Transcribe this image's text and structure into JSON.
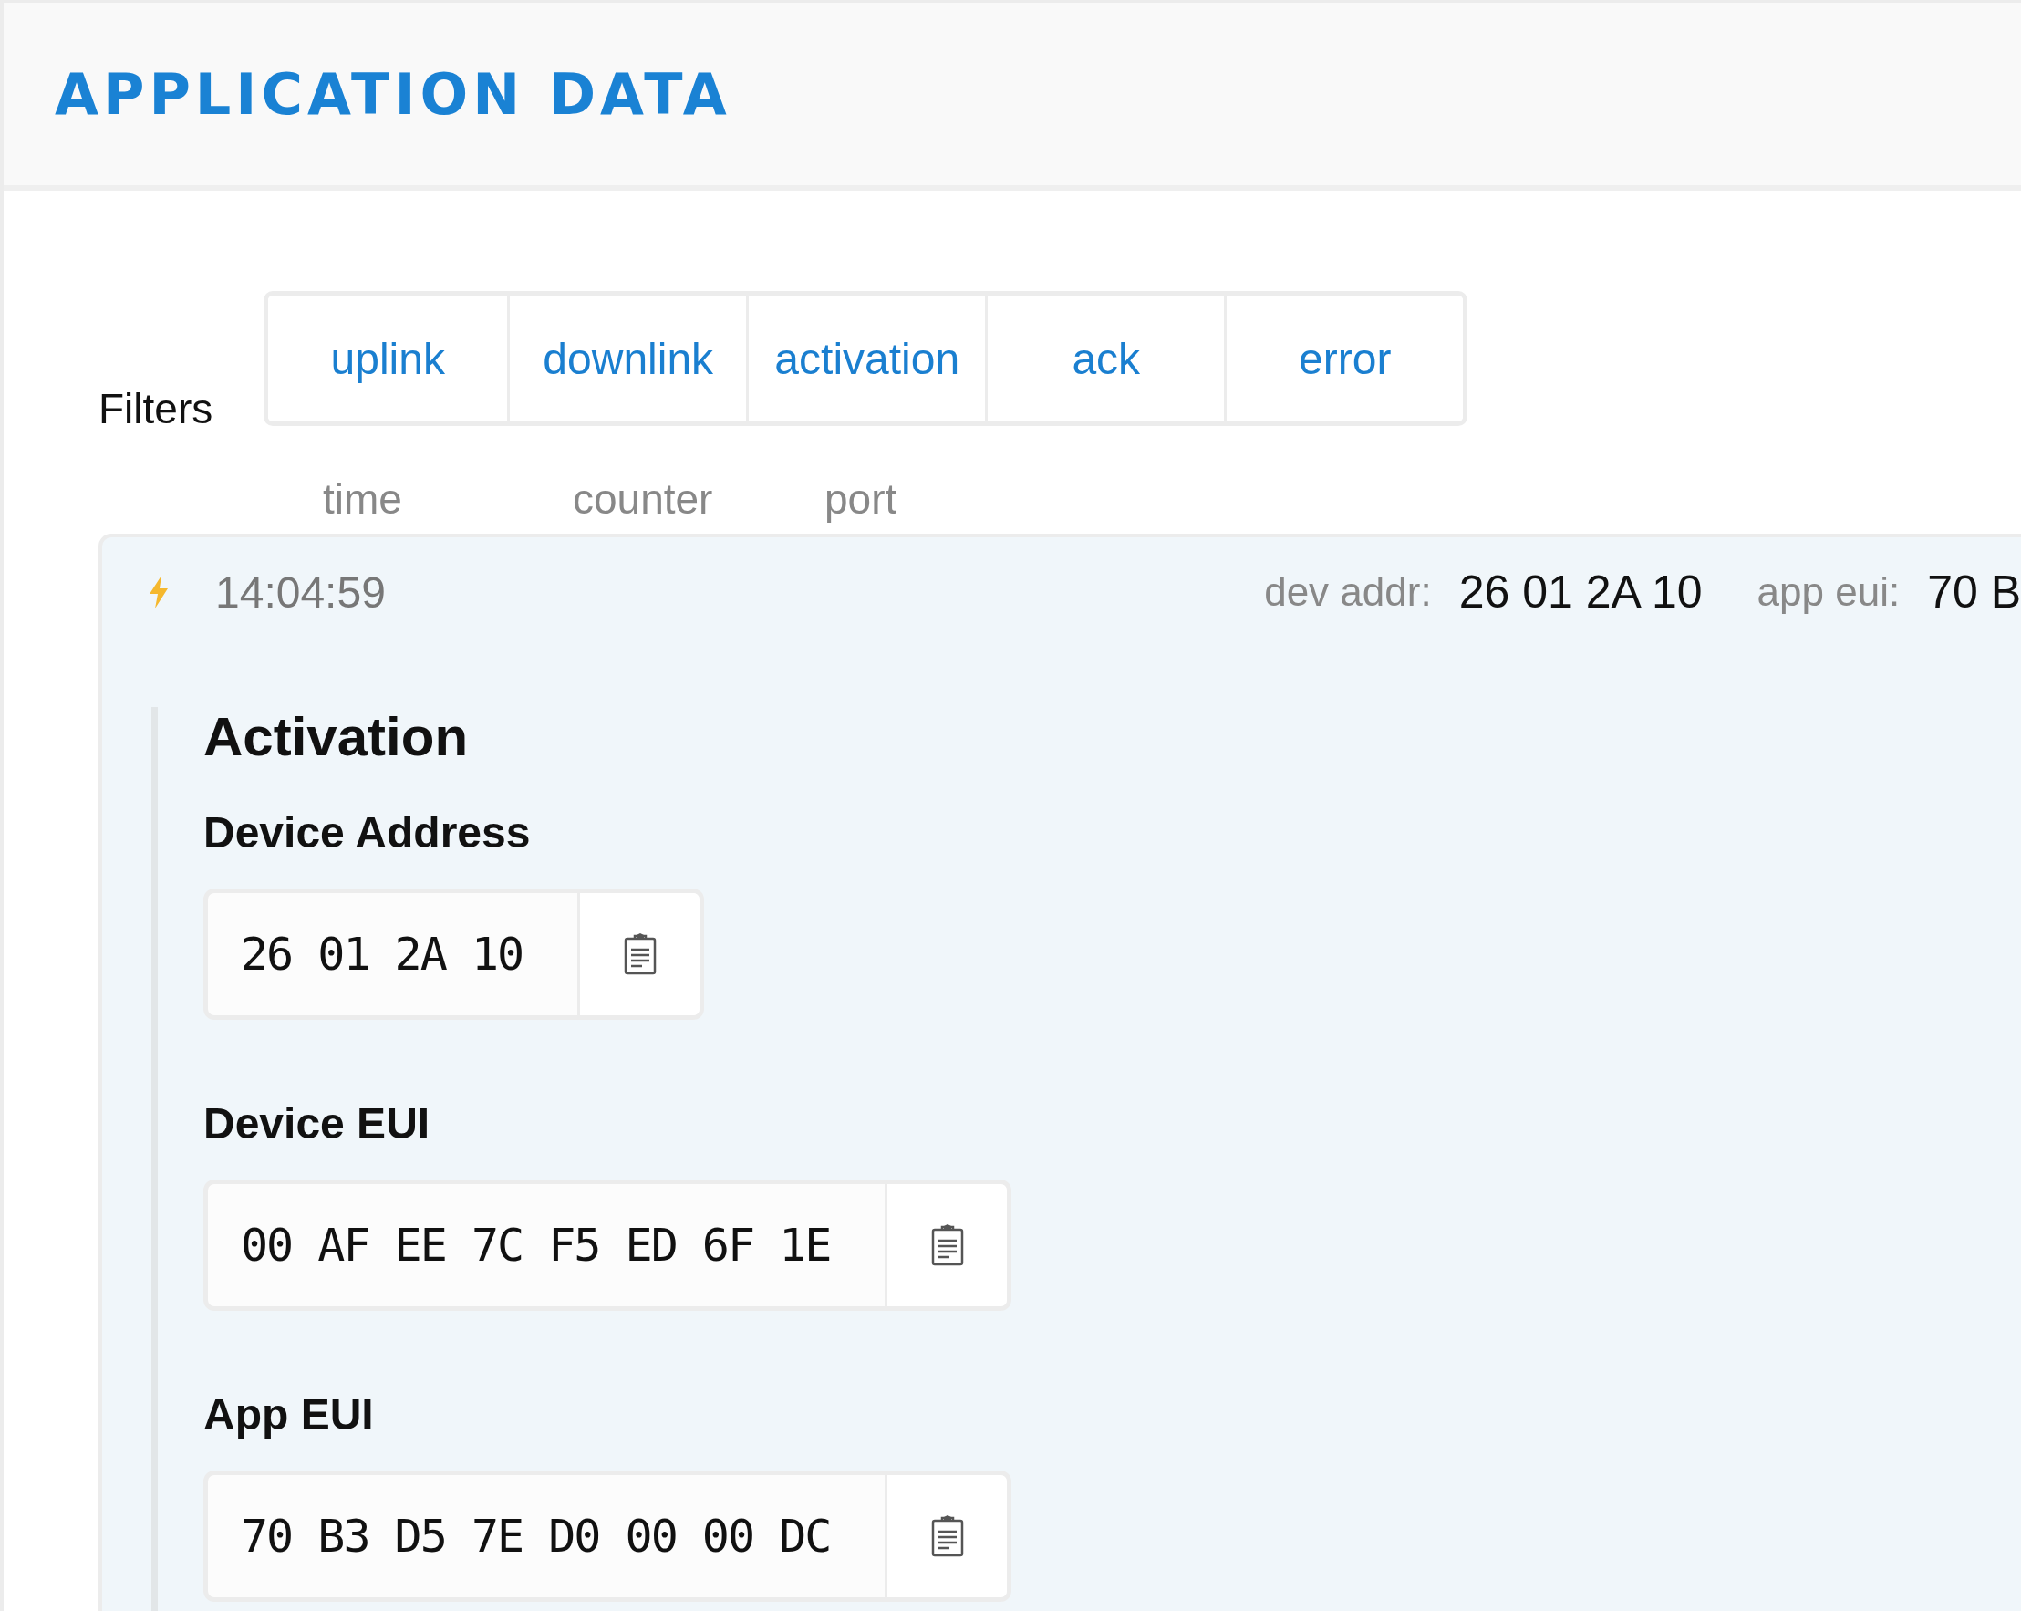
{
  "header": {
    "title": "APPLICATION DATA"
  },
  "filters": {
    "label": "Filters",
    "buttons": [
      "uplink",
      "downlink",
      "activation",
      "ack",
      "error"
    ]
  },
  "columns": [
    "time",
    "counter",
    "port"
  ],
  "event": {
    "time": "14:04:59",
    "meta": [
      {
        "label": "dev addr:",
        "value": "26 01 2A 10"
      },
      {
        "label": "app eui:",
        "value": "70 B"
      }
    ],
    "detail": {
      "title": "Activation",
      "fields": [
        {
          "label": "Device Address",
          "value": "26 01 2A 10"
        },
        {
          "label": "Device EUI",
          "value": "00 AF EE 7C F5 ED 6F 1E"
        },
        {
          "label": "App EUI",
          "value": "70 B3 D5 7E D0 00 00 DC"
        }
      ]
    }
  }
}
